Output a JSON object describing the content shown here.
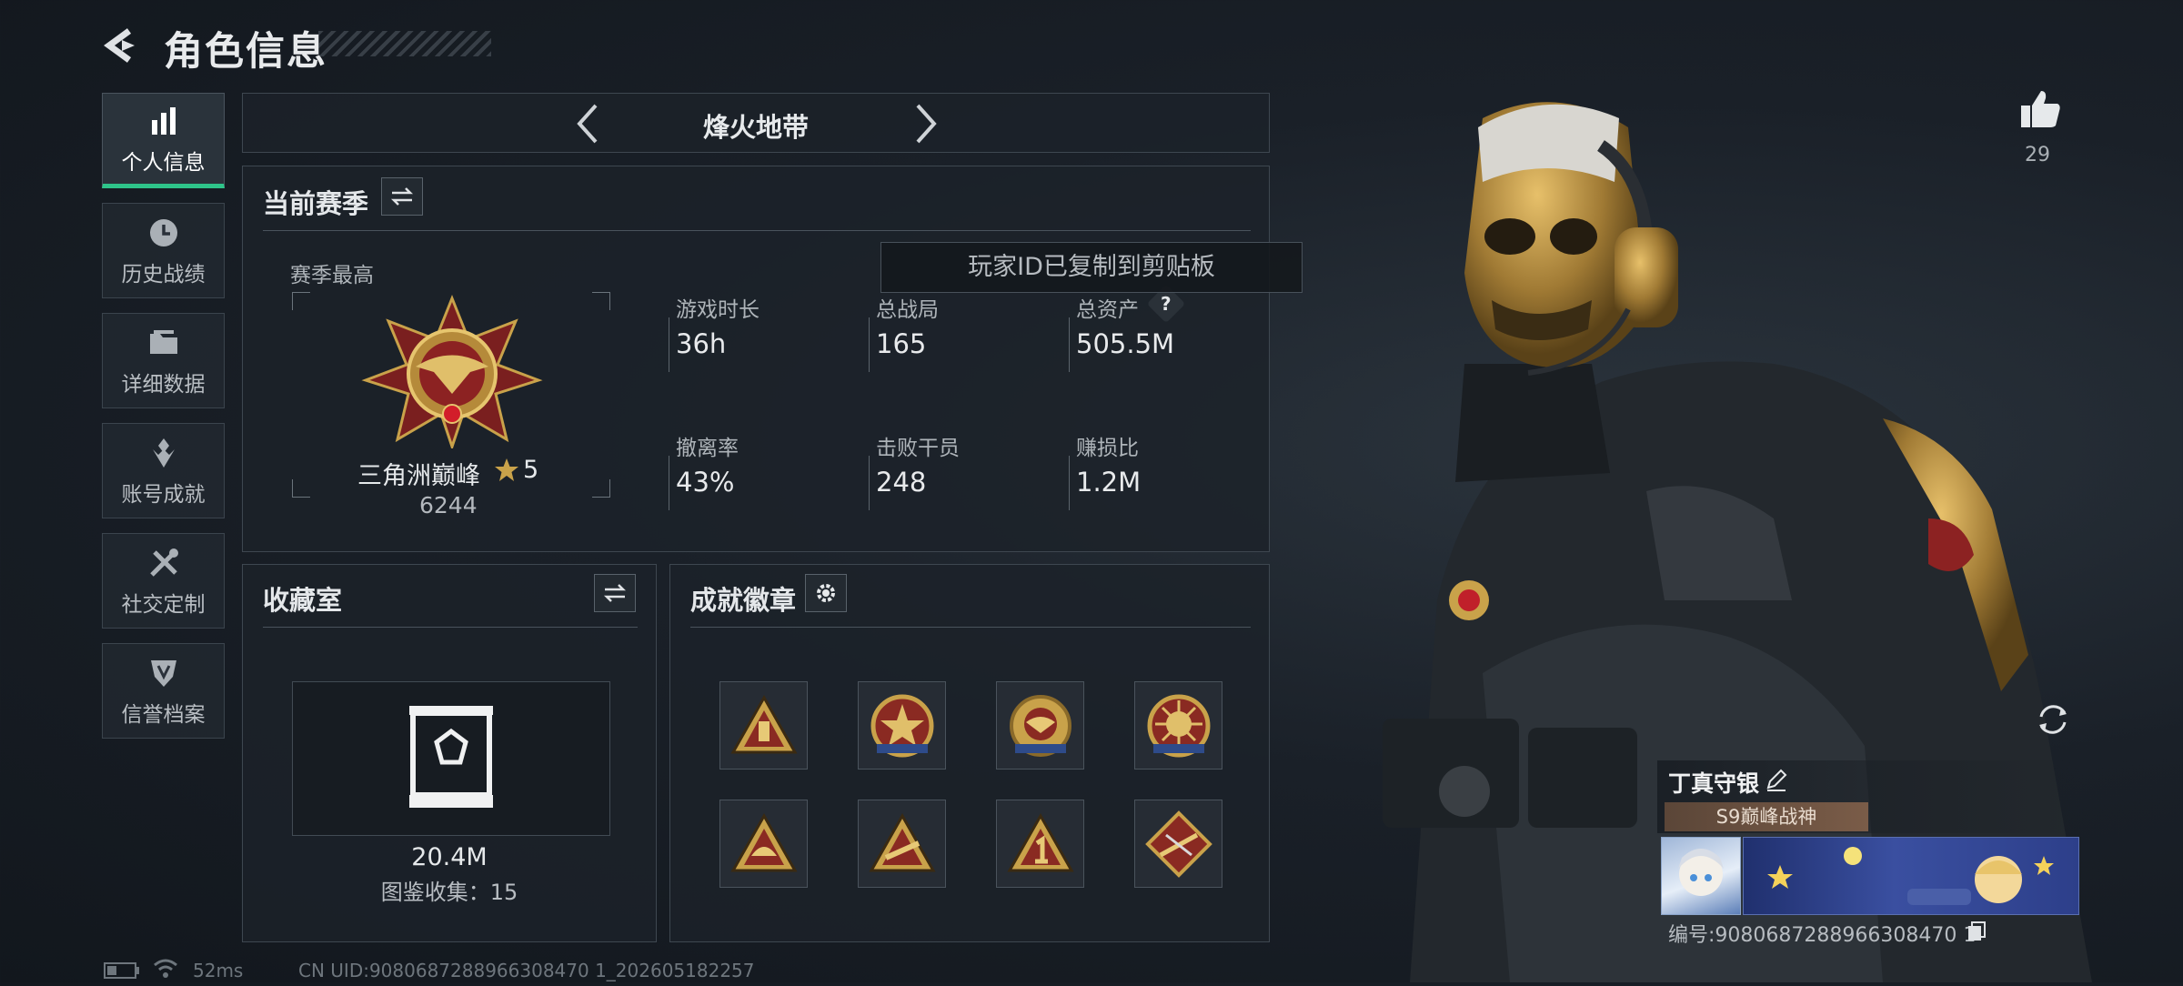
{
  "header": {
    "title": "角色信息"
  },
  "nav": {
    "items": [
      {
        "label": "个人信息",
        "icon": "bar-chart-icon",
        "active": true
      },
      {
        "label": "历史战绩",
        "icon": "clock-icon",
        "active": false
      },
      {
        "label": "详细数据",
        "icon": "folder-icon",
        "active": false
      },
      {
        "label": "账号成就",
        "icon": "achievement-icon",
        "active": false
      },
      {
        "label": "社交定制",
        "icon": "tools-icon",
        "active": false
      },
      {
        "label": "信誉档案",
        "icon": "shield-icon",
        "active": false
      }
    ]
  },
  "mode": {
    "title": "烽火地带"
  },
  "season": {
    "title": "当前赛季",
    "best_label": "赛季最高",
    "rank_name": "三角洲巅峰",
    "rank_stars": "5",
    "rank_points": "6244",
    "stats": [
      {
        "label": "游戏时长",
        "value": "36h"
      },
      {
        "label": "总战局",
        "value": "165"
      },
      {
        "label": "总资产",
        "value": "505.5M",
        "help": "?"
      },
      {
        "label": "撤离率",
        "value": "43%"
      },
      {
        "label": "击败干员",
        "value": "248"
      },
      {
        "label": "赚损比",
        "value": "1.2M"
      }
    ]
  },
  "toast": {
    "text": "玩家ID已复制到剪贴板"
  },
  "collection": {
    "title": "收藏室",
    "value": "20.4M",
    "count_text": "图鉴收集：15"
  },
  "achievements": {
    "title": "成就徽章",
    "badges": [
      "triangle-bottle-badge",
      "round-star-badge",
      "round-eagle-badge",
      "round-sun-badge",
      "triangle-helmet-badge",
      "triangle-weapon-badge",
      "triangle-number-one-badge",
      "diamond-rifle-badge"
    ]
  },
  "status_bar": {
    "ping": "52ms",
    "uid": "CN UID:9080687288966308470 1_202605182257"
  },
  "profile": {
    "likes": "29",
    "player_name": "丁真守银",
    "title_badge": "S9巅峰战神",
    "id_text": "编号:9080687288966308470 1"
  },
  "colors": {
    "accent_green": "#2ec48a",
    "gold": "#c9a24a"
  }
}
